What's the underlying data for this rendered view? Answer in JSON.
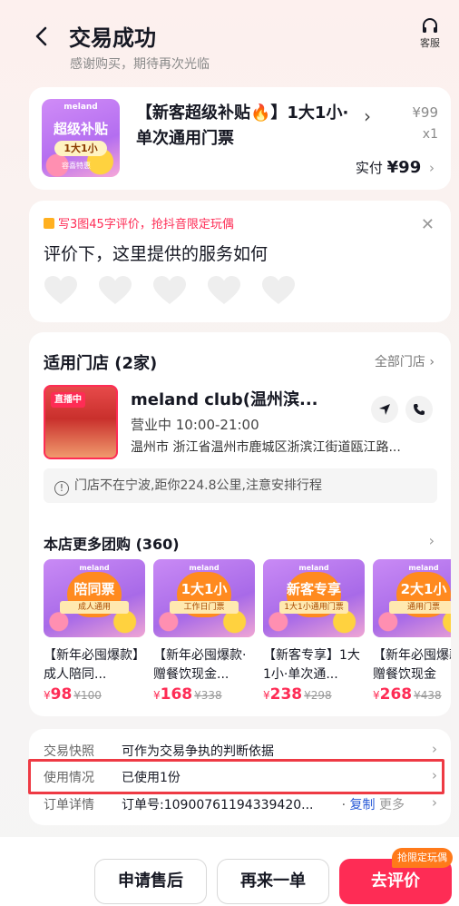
{
  "header": {
    "title": "交易成功",
    "subtitle": "感谢购买，期待再次光临",
    "service_label": "客服"
  },
  "product": {
    "thumb_brand": "meland",
    "thumb_line1": "超级补贴",
    "thumb_pill": "1大1小",
    "thumb_tag": "容喜特惠",
    "title": "【新客超级补贴🔥】1大1小·单次通用门票",
    "price": "¥99",
    "qty": "x1",
    "paid_label": "实付",
    "paid_value": "¥99"
  },
  "review": {
    "tip": "写3图45字评价，抢抖音限定玩偶",
    "question": "评价下，这里提供的服务如何",
    "heart_count": 5
  },
  "stores": {
    "title": "适用门店 (2家)",
    "all_link": "全部门店",
    "live_badge": "直播中",
    "name": "meland club(温州滨...",
    "hours": "营业中  10:00-21:00",
    "address": "温州市 浙江省温州市鹿城区浙滨江街道瓯江路...",
    "notice": "门店不在宁波,距你224.8公里,注意安排行程",
    "more_title": "本店更多团购 (360)",
    "deals": [
      {
        "brand": "meland",
        "main": "陪同票",
        "sub": "成人通用",
        "name": "【新年必囤爆款】成人陪同...",
        "price": "98",
        "original": "¥100"
      },
      {
        "brand": "meland",
        "main": "1大1小",
        "sub": "工作日门票",
        "name": "【新年必囤爆款·赠餐饮现金...",
        "price": "168",
        "original": "¥338"
      },
      {
        "brand": "meland",
        "main": "新客专享",
        "sub": "1大1小通用门票",
        "name": "【新客专享】1大1小·单次通...",
        "price": "238",
        "original": "¥298"
      },
      {
        "brand": "meland",
        "main": "2大1小",
        "sub": "通用门票",
        "name": "【新年必囤爆款·赠餐饮现金",
        "price": "268",
        "original": "¥438"
      }
    ]
  },
  "info": {
    "snapshot_label": "交易快照",
    "snapshot_value": "可作为交易争执的判断依据",
    "usage_label": "使用情况",
    "usage_value": "已使用1份",
    "order_label": "订单详情",
    "order_value": "订单号:10900761194339420...",
    "copy_label": "复制",
    "more_label": "更多"
  },
  "bottom": {
    "after_sale": "申请售后",
    "buy_again": "再来一单",
    "review": "去评价",
    "promo_badge": "抢限定玩偶"
  },
  "colors": {
    "accent": "#fe2c55",
    "highlight": "#ee3a44"
  }
}
